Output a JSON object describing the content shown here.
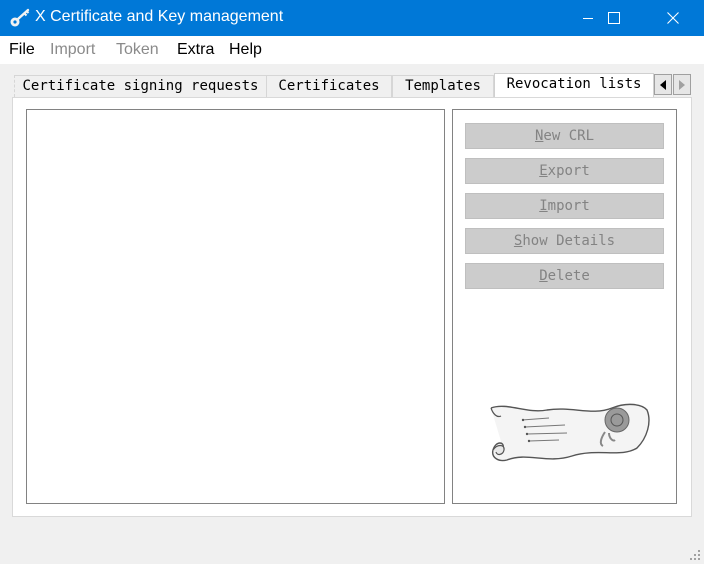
{
  "window": {
    "title": "X Certificate and Key management"
  },
  "menu": {
    "file": "File",
    "import": "Import",
    "token": "Token",
    "extra": "Extra",
    "help": "Help"
  },
  "tabs": {
    "csr": "Certificate signing requests",
    "certificates": "Certificates",
    "templates": "Templates",
    "revocation_lists": "Revocation lists",
    "active": "Revocation lists"
  },
  "actions": {
    "new_crl": {
      "accel": "N",
      "rest": "ew CRL"
    },
    "export": {
      "accel": "E",
      "rest": "xport"
    },
    "import": {
      "accel": "I",
      "rest": "mport"
    },
    "show_details": {
      "accel": "S",
      "rest": "how Details"
    },
    "delete": {
      "accel": "D",
      "rest": "elete"
    }
  },
  "icons": {
    "app": "key-icon",
    "minimize": "minimize-icon",
    "maximize": "maximize-icon",
    "close": "close-icon",
    "tab_scroll_left": "triangle-left-icon",
    "tab_scroll_right": "triangle-right-icon",
    "illustration": "scroll-document-icon",
    "resize": "resize-grip-icon"
  },
  "colors": {
    "titlebar": "#0078d7",
    "button_disabled_bg": "#cccccc",
    "button_disabled_text": "#838383"
  }
}
